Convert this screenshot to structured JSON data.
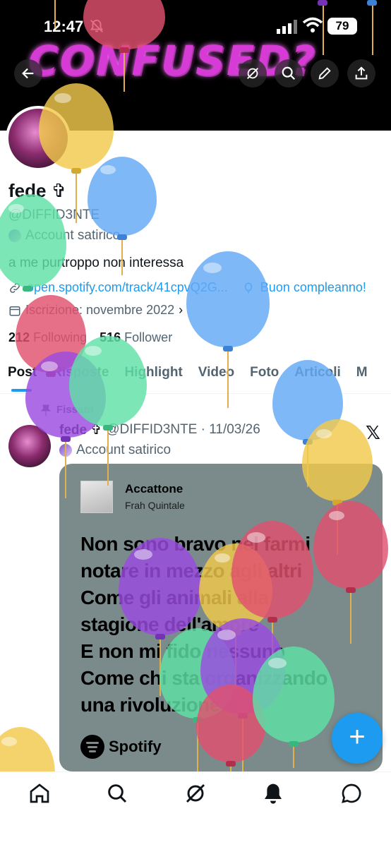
{
  "status": {
    "time": "12:47",
    "battery": "79"
  },
  "banner": {
    "art_text": "CONFUSED?"
  },
  "profile": {
    "name": "fede ✞",
    "handle": "@DIFFID3NTE",
    "label": "Account satirico",
    "bio": "a me purtroppo non interessa",
    "link": "open.spotify.com/track/41cpvQ2G...",
    "birthday": "Buon compleanno!",
    "joined": "Iscrizione: novembre 2022",
    "following_count": "212",
    "following_label": "Following",
    "followers_count": "516",
    "followers_label": "Follower"
  },
  "tabs": [
    "Post",
    "Risposte",
    "Highlight",
    "Video",
    "Foto",
    "Articoli",
    "M"
  ],
  "post": {
    "pinned_label": "Fissato",
    "name": "fede ✞",
    "meta": "@DIFFID3NTE · 11/03/26",
    "label": "Account satirico",
    "card": {
      "track": "Accattone",
      "artist": "Frah Quintale",
      "lyrics": [
        "Non sono bravo nel farmi",
        "notare in mezzo agli altri",
        "Come gli animali alla",
        "stagione dell'amore",
        "E non mi fido nessuno",
        "Come chi sta organizzando",
        "una rivoluzione"
      ],
      "brand": "Spotify"
    }
  },
  "fab": "+",
  "colors": {
    "accent": "#1d9bf0",
    "card_bg": "#7b8b8b"
  }
}
